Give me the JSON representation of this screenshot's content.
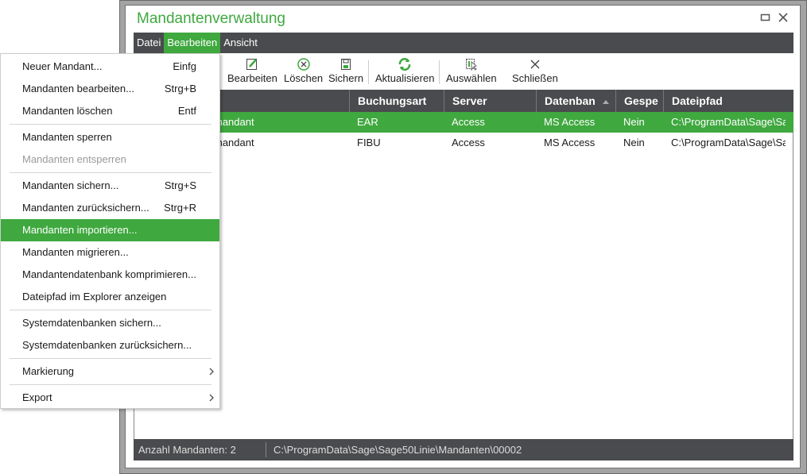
{
  "window": {
    "title": "Mandantenverwaltung",
    "maximize_icon": "maximize-icon",
    "close_icon": "close-icon"
  },
  "colors": {
    "accent": "#3fa83f",
    "dark": "#4a4b4e"
  },
  "menubar": {
    "items": [
      {
        "label": "Datei"
      },
      {
        "label": "Bearbeiten",
        "active": true
      },
      {
        "label": "Ansicht"
      }
    ]
  },
  "toolbar": {
    "items": [
      {
        "label": "Bearbeiten",
        "icon": "edit-icon"
      },
      {
        "label": "Löschen",
        "icon": "delete-circle-icon"
      },
      {
        "label": "Sichern",
        "icon": "save-icon"
      },
      {
        "label": "Aktualisieren",
        "icon": "refresh-icon"
      },
      {
        "label": "Auswählen",
        "icon": "select-icon"
      },
      {
        "label": "Schließen",
        "icon": "close-icon"
      }
    ]
  },
  "grid": {
    "columns": [
      "",
      "Buchungsart",
      "Server",
      "Datenban",
      "Gespe",
      "Dateipfad"
    ],
    "sort": {
      "column": "Datenban",
      "direction": "ascending"
    },
    "rows": [
      {
        "cells": [
          "mandant",
          "EAR",
          "Access",
          "MS Access",
          "Nein",
          "C:\\ProgramData\\Sage\\Sa"
        ],
        "selected": true
      },
      {
        "cells": [
          "mandant",
          "FIBU",
          "Access",
          "MS Access",
          "Nein",
          "C:\\ProgramData\\Sage\\Sa"
        ],
        "selected": false
      }
    ]
  },
  "status": {
    "count": "Anzahl Mandanten: 2",
    "path": "C:\\ProgramData\\Sage\\Sage50Linie\\Mandanten\\00002"
  },
  "menu": {
    "items": [
      {
        "label": "Neuer Mandant...",
        "shortcut": "Einfg"
      },
      {
        "label": "Mandanten bearbeiten...",
        "shortcut": "Strg+B"
      },
      {
        "label": "Mandanten löschen",
        "shortcut": "Entf"
      },
      {
        "label": "Mandanten sperren",
        "shortcut": ""
      },
      {
        "label": "Mandanten entsperren",
        "shortcut": "",
        "disabled": true
      },
      {
        "label": "Mandanten sichern...",
        "shortcut": "Strg+S"
      },
      {
        "label": "Mandanten zurücksichern...",
        "shortcut": "Strg+R"
      },
      {
        "label": "Mandanten importieren...",
        "shortcut": "",
        "highlighted": true
      },
      {
        "label": "Mandanten migrieren...",
        "shortcut": ""
      },
      {
        "label": "Mandantendatenbank komprimieren...",
        "shortcut": ""
      },
      {
        "label": "Dateipfad im Explorer anzeigen",
        "shortcut": ""
      },
      {
        "label": "Systemdatenbanken sichern...",
        "shortcut": ""
      },
      {
        "label": "Systemdatenbanken zurücksichern...",
        "shortcut": ""
      },
      {
        "label": "Markierung",
        "shortcut": "",
        "submenu": true
      },
      {
        "label": "Export",
        "shortcut": "",
        "submenu": true
      }
    ]
  }
}
